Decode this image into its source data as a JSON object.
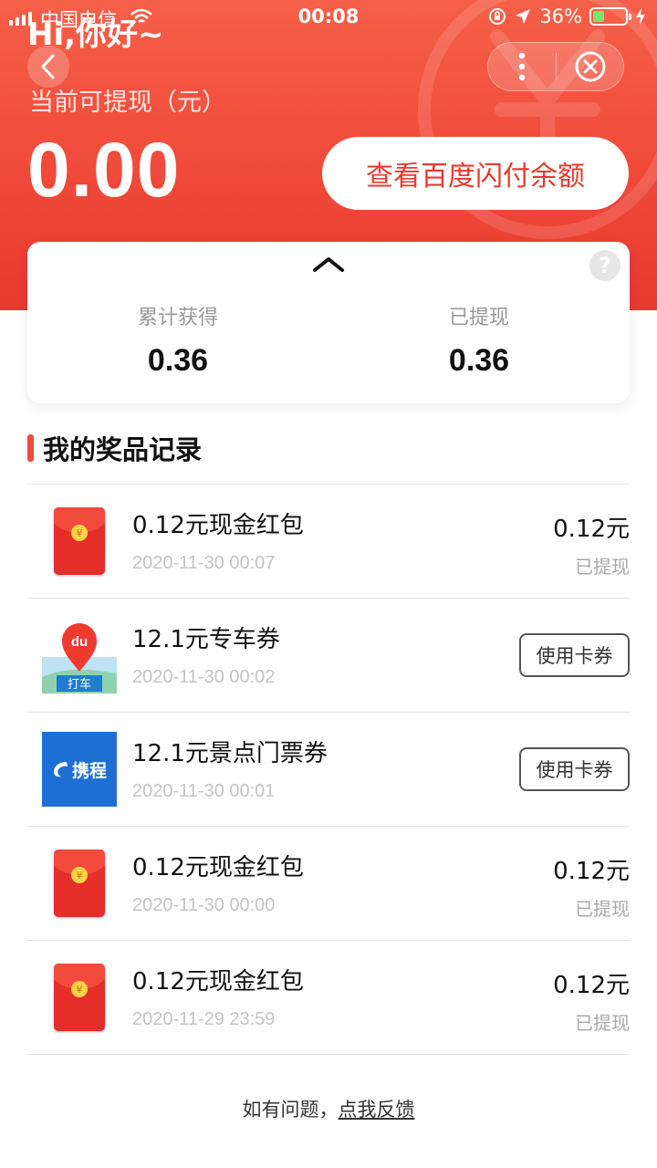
{
  "status_bar": {
    "carrier": "中国电信",
    "time": "00:08",
    "battery_percent": "36%",
    "battery_level": 0.36,
    "battery_color": "#7ee36a"
  },
  "header": {
    "greeting": "Hi,你好~",
    "back_icon": "chevron-left-icon",
    "more_icon": "more-vertical-icon",
    "close_icon": "close-circle-icon",
    "watermark_icon": "yuan-coin-icon"
  },
  "balance": {
    "label": "当前可提现（元）",
    "amount": "0.00",
    "view_button": "查看百度闪付余额"
  },
  "summary": {
    "collapse_icon": "chevron-up-icon",
    "help_icon": "?",
    "total_label": "累计获得",
    "total_value": "0.36",
    "withdrawn_label": "已提现",
    "withdrawn_value": "0.36"
  },
  "records": {
    "title": "我的奖品记录",
    "items": [
      {
        "icon": "red-envelope-icon",
        "title": "0.12元现金红包",
        "date": "2020-11-30 00:07",
        "amount": "0.12元",
        "status": "已提现"
      },
      {
        "icon": "didi-ride-icon",
        "icon_text": "du",
        "icon_subtext": "打车",
        "title": "12.1元专车券",
        "date": "2020-11-30 00:02",
        "button": "使用卡券"
      },
      {
        "icon": "ctrip-logo-icon",
        "icon_text": "携程",
        "title": "12.1元景点门票券",
        "date": "2020-11-30 00:01",
        "button": "使用卡券"
      },
      {
        "icon": "red-envelope-icon",
        "title": "0.12元现金红包",
        "date": "2020-11-30 00:00",
        "amount": "0.12元",
        "status": "已提现"
      },
      {
        "icon": "red-envelope-icon",
        "title": "0.12元现金红包",
        "date": "2020-11-29 23:59",
        "amount": "0.12元",
        "status": "已提现"
      }
    ]
  },
  "footer": {
    "prefix": "如有问题，",
    "link": "点我反馈"
  },
  "colors": {
    "brand_red": "#f04a3a",
    "button_text_red": "#e8392e"
  }
}
